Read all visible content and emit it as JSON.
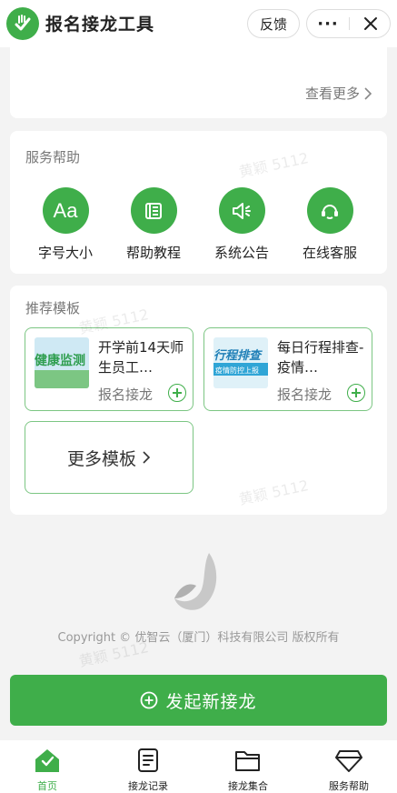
{
  "header": {
    "title": "报名接龙工具",
    "feedback_label": "反馈",
    "more_label": "···"
  },
  "recent": {
    "view_more_label": "查看更多"
  },
  "help": {
    "section_title": "服务帮助",
    "items": [
      {
        "label": "字号大小",
        "icon": "font-size-icon"
      },
      {
        "label": "帮助教程",
        "icon": "tutorial-icon"
      },
      {
        "label": "系统公告",
        "icon": "announcement-icon"
      },
      {
        "label": "在线客服",
        "icon": "customer-service-icon"
      }
    ],
    "font_icon_text": "Aa"
  },
  "templates": {
    "section_title": "推荐模板",
    "items": [
      {
        "title": "开学前14天师生员工…",
        "sub": "报名接龙",
        "thumb_text": "健康监测"
      },
      {
        "title": "每日行程排查-疫情…",
        "sub": "报名接龙",
        "thumb_text": "行程排查",
        "thumb_subtext": "疫情防控上报"
      }
    ],
    "more_label": "更多模板"
  },
  "watermark": "黄颖 5112",
  "copyright": "Copyright © 优智云（厦门）科技有限公司 版权所有",
  "launch_button_label": "发起新接龙",
  "tabs": [
    {
      "label": "首页",
      "icon": "home-icon",
      "active": true
    },
    {
      "label": "接龙记录",
      "icon": "record-icon",
      "active": false
    },
    {
      "label": "接龙集合",
      "icon": "folder-icon",
      "active": false
    },
    {
      "label": "服务帮助",
      "icon": "diamond-icon",
      "active": false
    }
  ],
  "colors": {
    "accent": "#3fae4a",
    "background": "#f3f3f3"
  }
}
